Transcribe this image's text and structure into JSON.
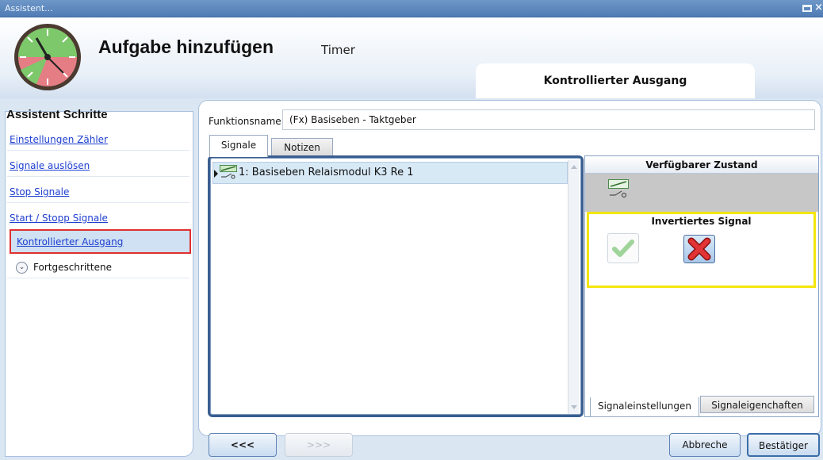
{
  "window": {
    "title": "Assistent..."
  },
  "header": {
    "title": "Aufgabe hinzufügen",
    "subtitle": "Timer",
    "current_step": "Kontrollierter Ausgang"
  },
  "sidebar": {
    "heading": "Assistent Schritte",
    "steps": [
      {
        "label": "Einstellungen Zähler"
      },
      {
        "label": "Signale auslösen"
      },
      {
        "label": "Stop Signale"
      },
      {
        "label": "Start / Stopp Signale"
      },
      {
        "label": "Kontrollierter Ausgang",
        "active": true
      }
    ],
    "advanced": {
      "label": "Fortgeschrittene",
      "icon": "chevron-down-icon"
    }
  },
  "main": {
    "function_name_label": "Funktionsname",
    "function_name_value": "(Fx) Basiseben - Taktgeber",
    "tabs": [
      {
        "label": "Signale"
      },
      {
        "label": "Notizen"
      }
    ],
    "signals": [
      {
        "label": "1: Basiseben Relaismodul K3 Re 1",
        "icon": "relay-icon"
      }
    ],
    "right_panel": {
      "available_state_title": "Verfügbarer Zustand",
      "inverted_signal_title": "Invertiertes Signal",
      "tabs": [
        {
          "label": "Signaleinstellungen"
        },
        {
          "label": "Signaleigenchaften"
        }
      ]
    }
  },
  "footer": {
    "prev_label": "<<<",
    "next_label": ">>>",
    "cancel_label": "Abbreche",
    "confirm_label": "Bestätiger"
  },
  "colors": {
    "highlight": "#f4e60b",
    "active_step_border": "#e03030",
    "link": "#1e3fcf"
  }
}
